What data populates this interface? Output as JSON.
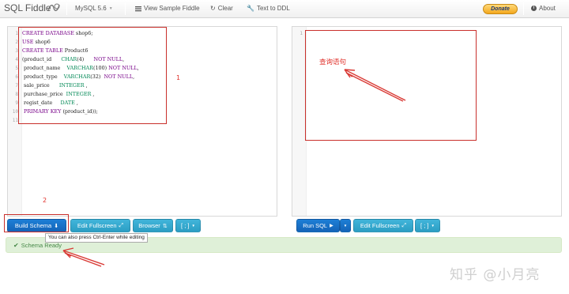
{
  "navbar": {
    "brand": "SQL Fiddle",
    "db_version": "MySQL 5.6",
    "view_sample": "View Sample Fiddle",
    "clear": "Clear",
    "text_to_ddl": "Text to DDL",
    "donate": "Donate",
    "about": "About"
  },
  "schema_editor": {
    "line_numbers": [
      "1",
      "2",
      "3",
      "4",
      "5",
      "6",
      "7",
      "8",
      "9",
      "10",
      "11"
    ],
    "lines": [
      "CREATE DATABASE shop6;",
      "USE shop6",
      "CREATE TABLE Product6",
      "(product_id      CHAR(4)      NOT NULL,",
      " product_name    VARCHAR(100) NOT NULL,",
      " product_type    VARCHAR(32)  NOT NULL,",
      " sale_price      INTEGER ,",
      " purchase_price  INTEGER ,",
      " regist_date     DATE ,",
      " PRIMARY KEY (product_id));",
      ""
    ]
  },
  "query_editor": {
    "line_numbers": [
      "1"
    ]
  },
  "annotations": {
    "label_1": "1",
    "label_2": "2",
    "query_label": "查询语句"
  },
  "left_toolbar": {
    "build_schema": "Build Schema",
    "edit_fullscreen": "Edit Fullscreen",
    "browser": "Browser",
    "delimiter": "[ ; ]"
  },
  "right_toolbar": {
    "run_sql": "Run SQL",
    "edit_fullscreen": "Edit Fullscreen",
    "delimiter": "[ ; ]"
  },
  "tooltip": "You can also press Ctrl-Enter while editing",
  "status": {
    "text": "Schema Ready"
  },
  "watermark": "知乎 @小月亮",
  "colors": {
    "primary": "#1464b8",
    "info": "#2c9ec4",
    "annotation_red": "#c9302c",
    "success_bg": "#dff0d8"
  }
}
